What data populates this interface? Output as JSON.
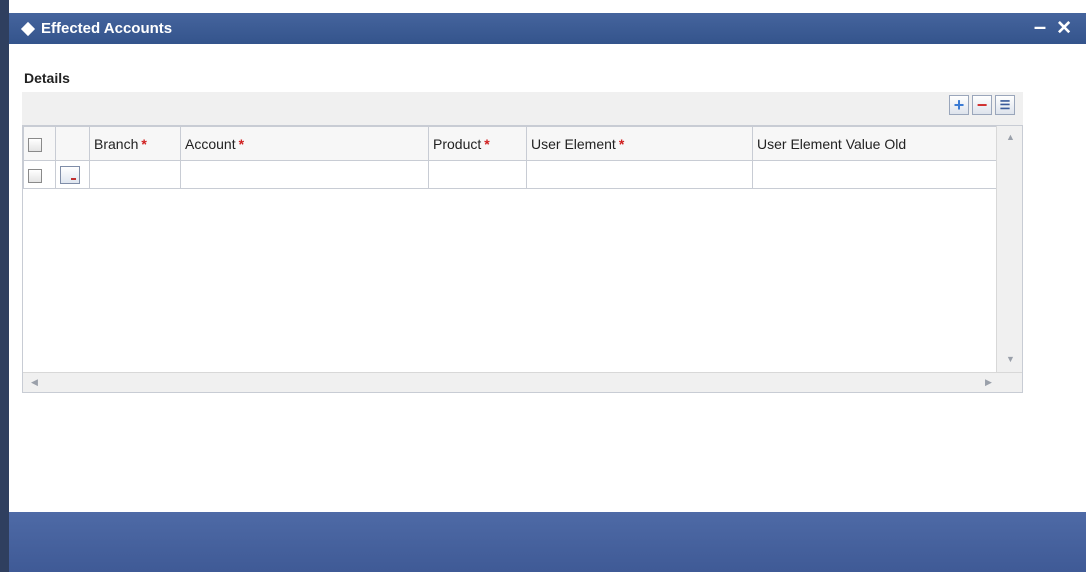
{
  "window": {
    "title": "Effected Accounts",
    "minimize_label": "–",
    "close_label": "✕"
  },
  "section": {
    "label": "Details"
  },
  "toolbar": {
    "add_label": "+",
    "delete_label": "−",
    "list_label": "☰"
  },
  "table": {
    "columns": [
      {
        "label": "Branch",
        "required": "*"
      },
      {
        "label": "Account",
        "required": "*"
      },
      {
        "label": "Product",
        "required": "*"
      },
      {
        "label": "User Element",
        "required": "*"
      },
      {
        "label": "User Element Value Old",
        "required": ""
      }
    ],
    "rows": [
      {
        "branch": "",
        "account": "",
        "product": "",
        "user_element": "",
        "user_element_value_old": ""
      }
    ]
  },
  "scrollbars": {
    "up_arrow": "▲",
    "down_arrow": "▼",
    "left_arrow": "◀",
    "right_arrow": "▶"
  },
  "colors": {
    "titlebar": "#3a5a94",
    "footer": "#4662a0",
    "required": "#d02020"
  },
  "icons": [
    "diamond-icon",
    "minimize-icon",
    "close-icon",
    "add-icon",
    "delete-icon",
    "list-icon",
    "row-detail-icon"
  ]
}
